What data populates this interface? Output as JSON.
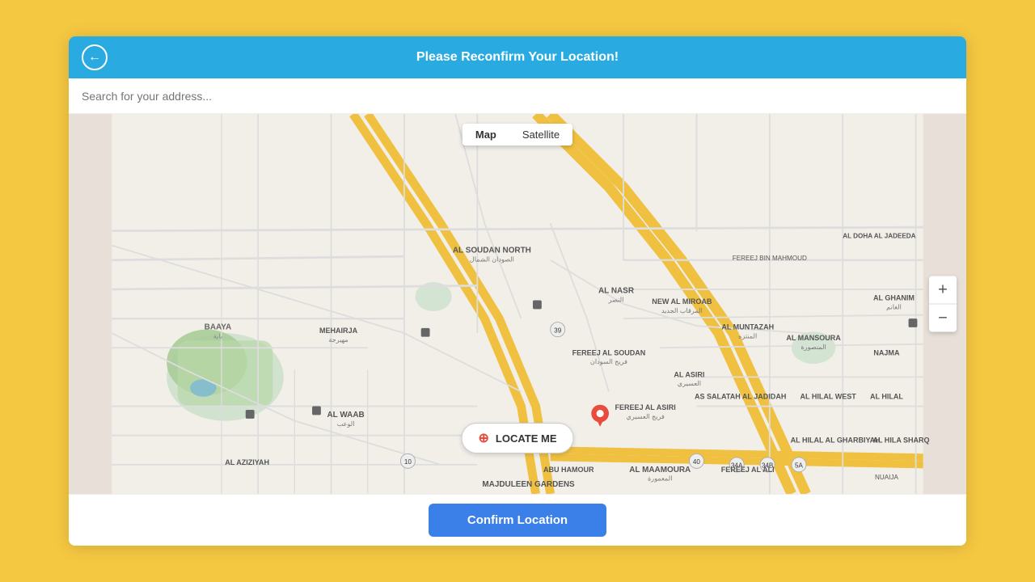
{
  "header": {
    "title": "Please Reconfirm Your Location!",
    "back_label": "←"
  },
  "search": {
    "placeholder": "Search for your address..."
  },
  "map": {
    "type_buttons": [
      {
        "label": "Map",
        "active": true
      },
      {
        "label": "Satellite",
        "active": false
      }
    ],
    "zoom_in_label": "+",
    "zoom_out_label": "−"
  },
  "locate_me": {
    "label": "LOCATE ME"
  },
  "confirm": {
    "label": "Confirm Location"
  }
}
